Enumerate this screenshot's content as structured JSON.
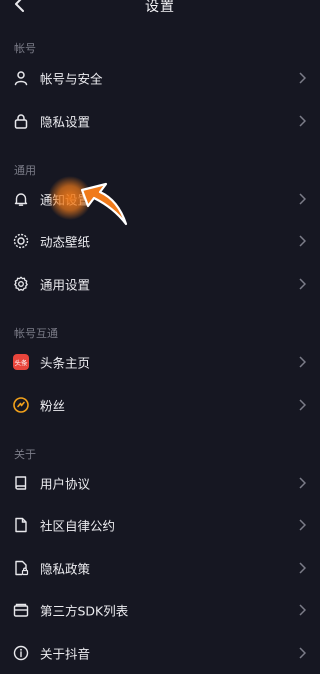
{
  "header": {
    "title": "设置"
  },
  "sections": [
    {
      "label": "帐号"
    },
    {
      "label": "通用"
    },
    {
      "label": "帐号互通"
    },
    {
      "label": "关于"
    }
  ],
  "rows": {
    "account_security": "帐号与安全",
    "privacy_settings": "隐私设置",
    "notification_settings": "通知设置",
    "live_wallpaper": "动态壁纸",
    "general_settings": "通用设置",
    "toutiao_home": "头条主页",
    "fans": "粉丝",
    "user_agreement": "用户协议",
    "community_rules": "社区自律公约",
    "privacy_policy": "隐私政策",
    "third_party_sdk": "第三方SDK列表",
    "about": "关于抖音"
  },
  "badges": {
    "toutiao": "头条"
  },
  "colors": {
    "background": "#161722",
    "pointer": "#f07a1a",
    "toutiao_red": "#e8453c",
    "fans_orange": "#f3a21b"
  }
}
